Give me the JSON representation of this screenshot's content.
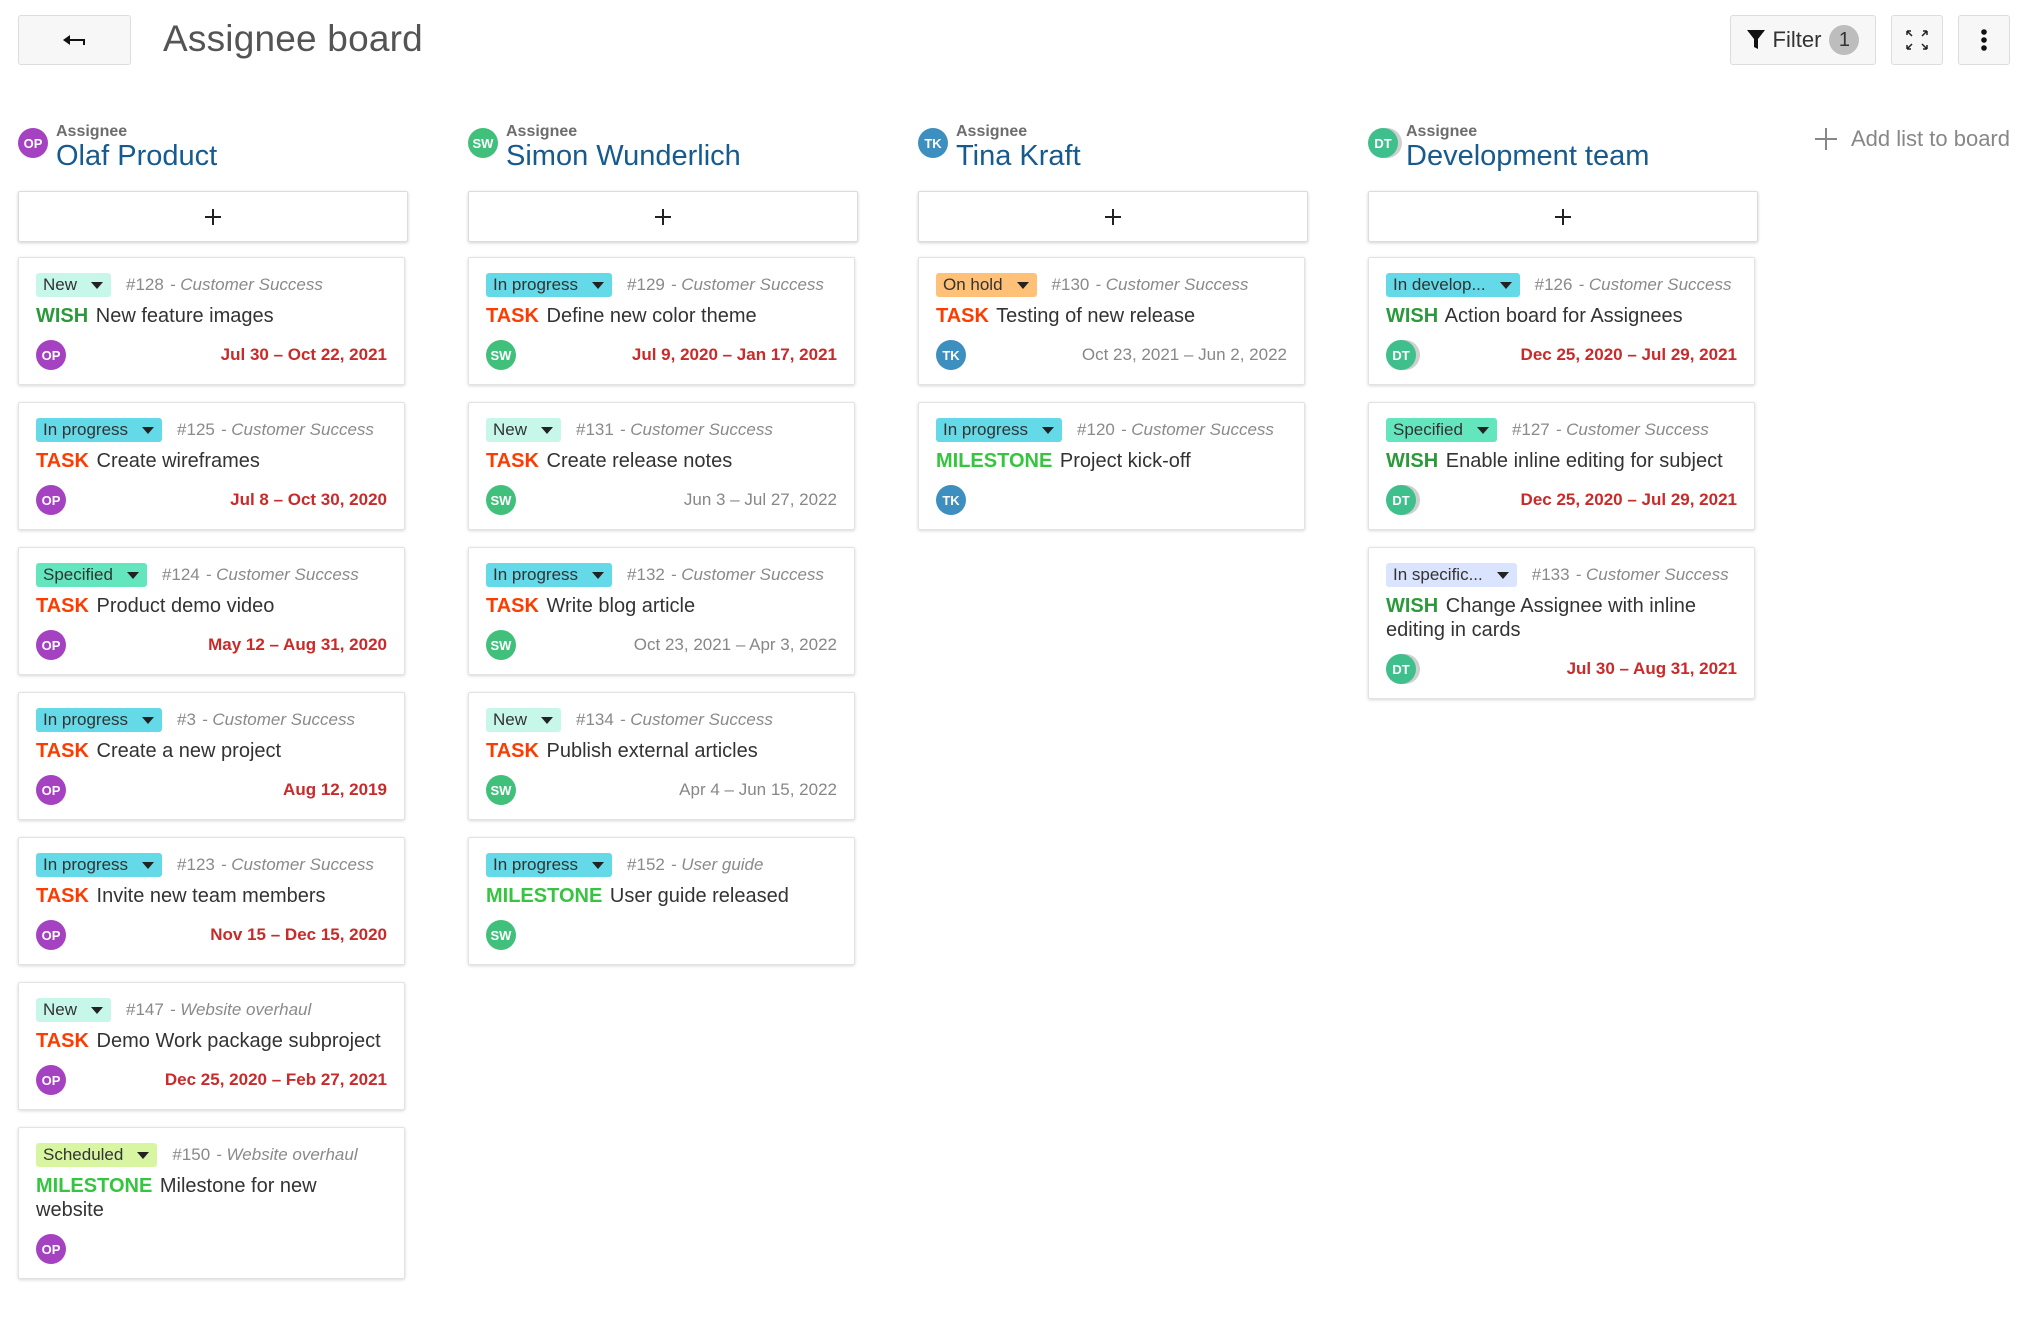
{
  "header": {
    "title": "Assignee board",
    "back_label": "",
    "filter_label": "Filter",
    "filter_count": "1"
  },
  "add_list_label": "Add list to board",
  "colors": {
    "type_task": "#ff3c00",
    "type_wish": "#2c9a3a",
    "type_milestone": "#35c53f",
    "overdue": "#c92a2a"
  },
  "columns": [
    {
      "label": "Assignee",
      "name": "Olaf Product",
      "initials": "OP",
      "avatar_color": "#a542c1",
      "group": false,
      "cards": [
        {
          "status": "New",
          "status_color": "#c6f7e9",
          "id": "#128",
          "project": "- Customer Success",
          "type": "WISH",
          "type_color": "#2c9a3a",
          "subject": "New feature images",
          "dates": "Jul 30 – Oct 22, 2021",
          "overdue": true
        },
        {
          "status": "In progress",
          "status_color": "#64d9e8",
          "id": "#125",
          "project": "- Customer Success",
          "type": "TASK",
          "type_color": "#ff3c00",
          "subject": "Create wireframes",
          "dates": "Jul 8 – Oct 30, 2020",
          "overdue": true
        },
        {
          "status": "Specified",
          "status_color": "#63e6be",
          "id": "#124",
          "project": "- Customer Success",
          "type": "TASK",
          "type_color": "#ff3c00",
          "subject": "Product demo video",
          "dates": "May 12 – Aug 31, 2020",
          "overdue": true
        },
        {
          "status": "In progress",
          "status_color": "#64d9e8",
          "id": "#3",
          "project": "- Customer Success",
          "type": "TASK",
          "type_color": "#ff3c00",
          "subject": "Create a new project",
          "dates": "Aug 12, 2019",
          "overdue": true
        },
        {
          "status": "In progress",
          "status_color": "#64d9e8",
          "id": "#123",
          "project": "- Customer Success",
          "type": "TASK",
          "type_color": "#ff3c00",
          "subject": "Invite new team members",
          "dates": "Nov 15 – Dec 15, 2020",
          "overdue": true
        },
        {
          "status": "New",
          "status_color": "#c6f7e9",
          "id": "#147",
          "project": "- Website overhaul",
          "type": "TASK",
          "type_color": "#ff3c00",
          "subject": "Demo Work package subproject",
          "dates": "Dec 25, 2020 – Feb 27, 2021",
          "overdue": true
        },
        {
          "status": "Scheduled",
          "status_color": "#d8f5a2",
          "id": "#150",
          "project": "- Website overhaul",
          "type": "MILESTONE",
          "type_color": "#35c53f",
          "subject": "Milestone for new website",
          "dates": "",
          "overdue": false
        }
      ]
    },
    {
      "label": "Assignee",
      "name": "Simon Wunderlich",
      "initials": "SW",
      "avatar_color": "#41c07b",
      "group": false,
      "cards": [
        {
          "status": "In progress",
          "status_color": "#64d9e8",
          "id": "#129",
          "project": "- Customer Success",
          "type": "TASK",
          "type_color": "#ff3c00",
          "subject": "Define new color theme",
          "dates": "Jul 9, 2020 – Jan 17, 2021",
          "overdue": true
        },
        {
          "status": "New",
          "status_color": "#c6f7e9",
          "id": "#131",
          "project": "- Customer Success",
          "type": "TASK",
          "type_color": "#ff3c00",
          "subject": "Create release notes",
          "dates": "Jun 3 – Jul 27, 2022",
          "overdue": false
        },
        {
          "status": "In progress",
          "status_color": "#64d9e8",
          "id": "#132",
          "project": "- Customer Success",
          "type": "TASK",
          "type_color": "#ff3c00",
          "subject": "Write blog article",
          "dates": "Oct 23, 2021 – Apr 3, 2022",
          "overdue": false
        },
        {
          "status": "New",
          "status_color": "#c6f7e9",
          "id": "#134",
          "project": "- Customer Success",
          "type": "TASK",
          "type_color": "#ff3c00",
          "subject": "Publish external articles",
          "dates": "Apr 4 – Jun 15, 2022",
          "overdue": false
        },
        {
          "status": "In progress",
          "status_color": "#64d9e8",
          "id": "#152",
          "project": "- User guide",
          "type": "MILESTONE",
          "type_color": "#35c53f",
          "subject": "User guide released",
          "dates": "",
          "overdue": false
        }
      ]
    },
    {
      "label": "Assignee",
      "name": "Tina Kraft",
      "initials": "TK",
      "avatar_color": "#3d8fbf",
      "group": false,
      "cards": [
        {
          "status": "On hold",
          "status_color": "#ffc078",
          "id": "#130",
          "project": "- Customer Success",
          "type": "TASK",
          "type_color": "#ff3c00",
          "subject": "Testing of new release",
          "dates": "Oct 23, 2021 – Jun 2, 2022",
          "overdue": false
        },
        {
          "status": "In progress",
          "status_color": "#64d9e8",
          "id": "#120",
          "project": "- Customer Success",
          "type": "MILESTONE",
          "type_color": "#35c53f",
          "subject": "Project kick-off",
          "dates": "",
          "overdue": false
        }
      ]
    },
    {
      "label": "Assignee",
      "name": "Development team",
      "initials": "DT",
      "avatar_color": "#3ebf8c",
      "group": true,
      "cards": [
        {
          "status": "In develop...",
          "status_color": "#64d9e8",
          "id": "#126",
          "project": "- Customer Success",
          "type": "WISH",
          "type_color": "#2c9a3a",
          "subject": "Action board for Assignees",
          "dates": "Dec 25, 2020 – Jul 29, 2021",
          "overdue": true
        },
        {
          "status": "Specified",
          "status_color": "#63e6be",
          "id": "#127",
          "project": "- Customer Success",
          "type": "WISH",
          "type_color": "#2c9a3a",
          "subject": "Enable inline editing for subject",
          "dates": "Dec 25, 2020 – Jul 29, 2021",
          "overdue": true
        },
        {
          "status": "In specific...",
          "status_color": "#dbe4ff",
          "id": "#133",
          "project": "- Customer Success",
          "type": "WISH",
          "type_color": "#2c9a3a",
          "subject": "Change Assignee with inline editing in cards",
          "dates": "Jul 30 – Aug 31, 2021",
          "overdue": true
        }
      ]
    }
  ]
}
